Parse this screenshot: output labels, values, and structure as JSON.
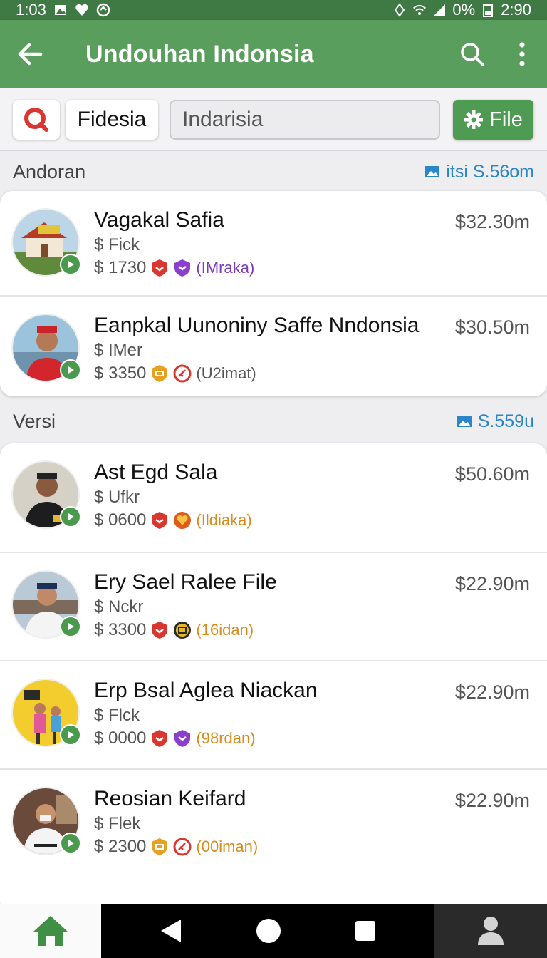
{
  "status_bar": {
    "time": "1:03",
    "battery": "0%",
    "clock": "2:90"
  },
  "app_bar": {
    "title": "Undouhan Indonsia"
  },
  "filters": {
    "chip_label": "Fidesia",
    "search_value": "Indarisia",
    "file_button": "File"
  },
  "sections": [
    {
      "title": "Andoran",
      "meta": "itsi S.56om"
    },
    {
      "title": "Versi",
      "meta": "S.559u"
    }
  ],
  "list1": [
    {
      "name": "Vagakal Safia",
      "sub": "$ Fick",
      "amount": "$ 1730",
      "tag": "(IMraka)",
      "price": "$32.30m"
    },
    {
      "name": "Eanpkal Uunoniny Saffe Nndonsia",
      "sub": "$ IMer",
      "amount": "$ 3350",
      "tag": "(U2imat)",
      "price": "$30.50m"
    }
  ],
  "list2": [
    {
      "name": "Ast Egd Sala",
      "sub": "$ Ufkr",
      "amount": "$ 0600",
      "tag": "(Ildiaka)",
      "price": "$50.60m"
    },
    {
      "name": "Ery Sael Ralee File",
      "sub": "$ Nckr",
      "amount": "$ 3300",
      "tag": "(16idan)",
      "price": "$22.90m"
    },
    {
      "name": "Erp Bsal Aglea Niackan",
      "sub": "$ Flck",
      "amount": "$ 0000",
      "tag": "(98rdan)",
      "price": "$22.90m"
    },
    {
      "name": "Reosian Keifard",
      "sub": "$ Flek",
      "amount": "$ 2300",
      "tag": "(00iman)",
      "price": "$22.90m"
    }
  ],
  "colors": {
    "appbar": "#5a9e5e",
    "statusbar": "#3f7a45",
    "accent_green": "#4f9b53",
    "link_blue": "#2b86c9",
    "badge_red": "#d9362f",
    "badge_purple": "#8a3fcf",
    "badge_orange": "#e8a020",
    "tag_purple": "#7a3cb8",
    "tag_orange": "#d98a1a"
  }
}
